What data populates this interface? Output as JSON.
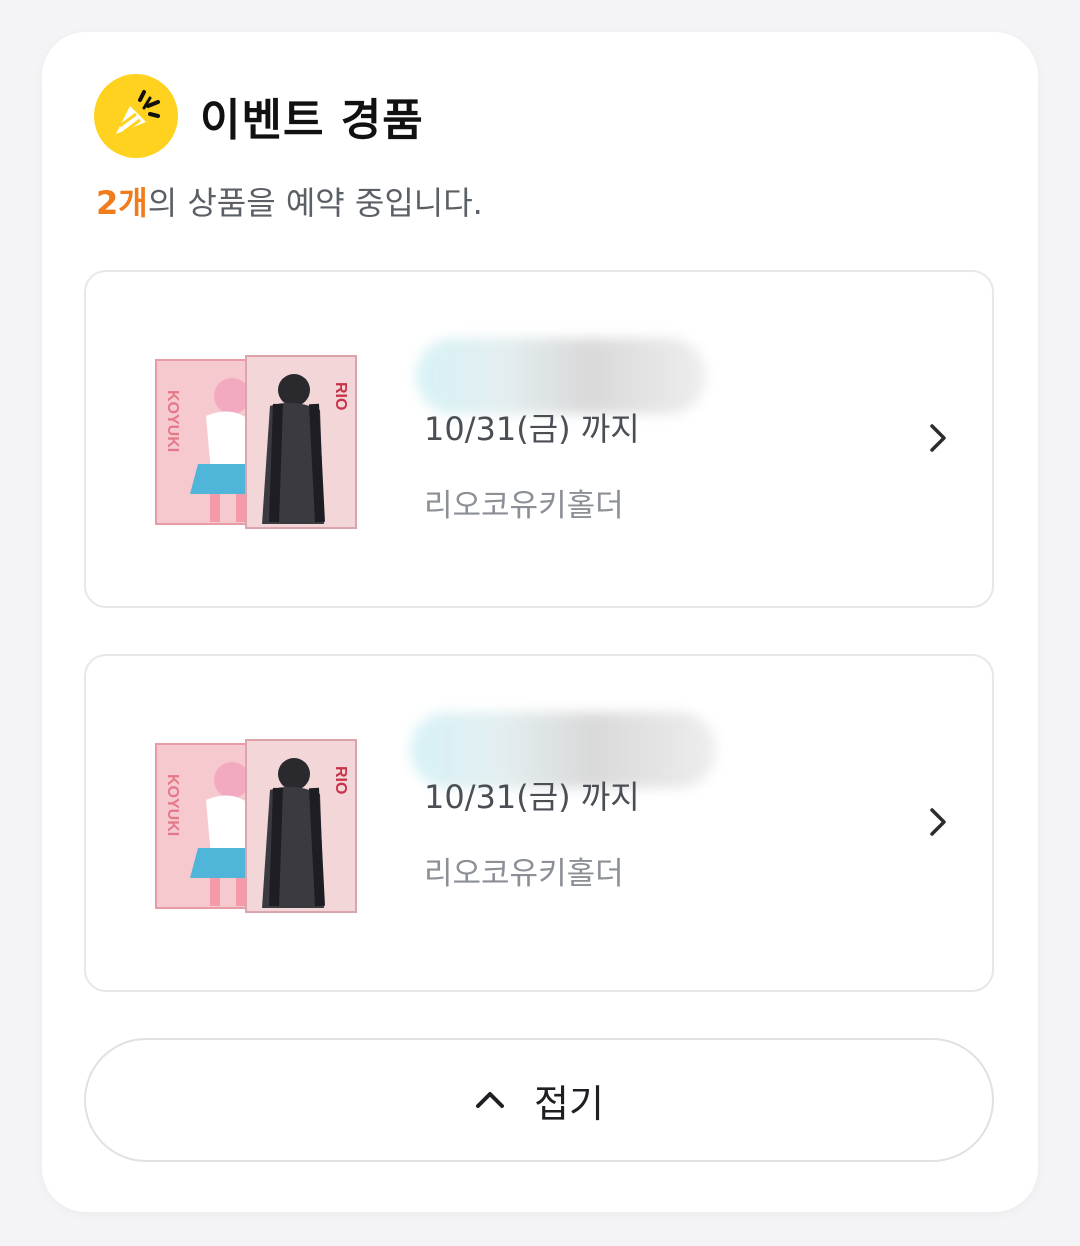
{
  "header": {
    "title": "이벤트 경품",
    "subtitle_count": "2개",
    "subtitle_rest": "의 상품을 예약 중입니다.",
    "icon": "party-popper-icon",
    "accent_color": "#f07c1b",
    "icon_bg": "#ffd21f"
  },
  "items": [
    {
      "date": "10/31(금) 까지",
      "product": "리오코유키홀더",
      "thumb_labels": [
        "KOYUKI",
        "RIO"
      ]
    },
    {
      "date": "10/31(금) 까지",
      "product": "리오코유키홀더",
      "thumb_labels": [
        "KOYUKI",
        "RIO"
      ]
    }
  ],
  "collapse": {
    "label": "접기",
    "icon": "chevron-up-icon"
  }
}
